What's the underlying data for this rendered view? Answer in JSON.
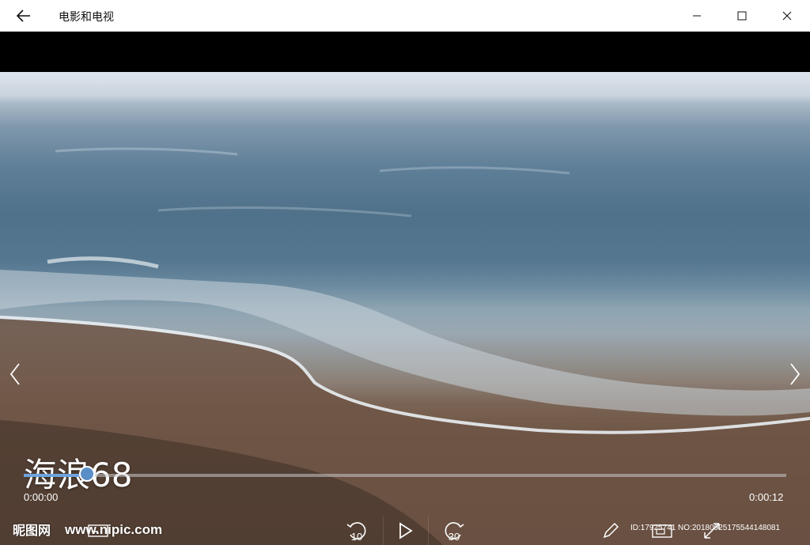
{
  "window": {
    "title": "电影和电视",
    "back_icon": "arrow-left-icon",
    "minimize_icon": "minimize-icon",
    "maximize_icon": "maximize-icon",
    "close_icon": "close-icon"
  },
  "video": {
    "title": "海浪68",
    "prev_icon": "chevron-left-icon",
    "next_icon": "chevron-right-icon"
  },
  "playback": {
    "current_time": "0:00:00",
    "total_time": "0:00:12",
    "progress_fraction": 0.083
  },
  "controls": {
    "rewind_label": "10",
    "forward_label": "30",
    "rewind_icon": "skip-back-icon",
    "play_icon": "play-icon",
    "forward_icon": "skip-forward-icon",
    "edit_icon": "pencil-icon",
    "cast_icon": "cast-icon",
    "fullscreen_icon": "fullscreen-icon",
    "subtitles_icon": "subtitles-icon"
  },
  "watermark": {
    "logo_text": "昵图网",
    "site_text": "www.nipic.com",
    "id_text": "ID:17925741 NO:20180925175544148081"
  },
  "colors": {
    "accent": "#6ea3dc",
    "titlebar": "#ffffff"
  }
}
